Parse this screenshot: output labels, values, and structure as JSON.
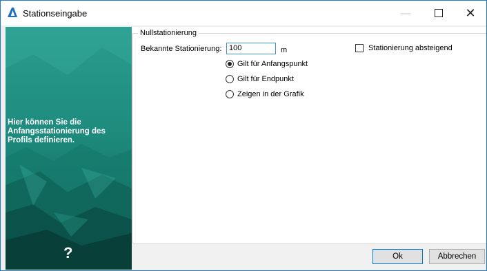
{
  "window": {
    "title": "Stationseingabe",
    "controls": {
      "minimize": "—",
      "maximize": "☐",
      "close": "✕"
    }
  },
  "sidebar": {
    "text": "Hier können Sie die Anfangsstationierung des Profils definieren.",
    "help": "?"
  },
  "group": {
    "legend": "Nullstationierung",
    "known_label": "Bekannte Stationierung:",
    "known_value": "100",
    "unit": "m",
    "descending_label": "Stationierung absteigend",
    "descending_checked": false,
    "radios": [
      {
        "label": "Gilt für Anfangspunkt",
        "checked": true
      },
      {
        "label": "Gilt für Endpunkt",
        "checked": false
      },
      {
        "label": "Zeigen in der Grafik",
        "checked": false
      }
    ]
  },
  "buttons": {
    "ok": "Ok",
    "cancel": "Abbrechen"
  },
  "colors": {
    "accent": "#0078d7",
    "panel": "#1d8f82"
  }
}
